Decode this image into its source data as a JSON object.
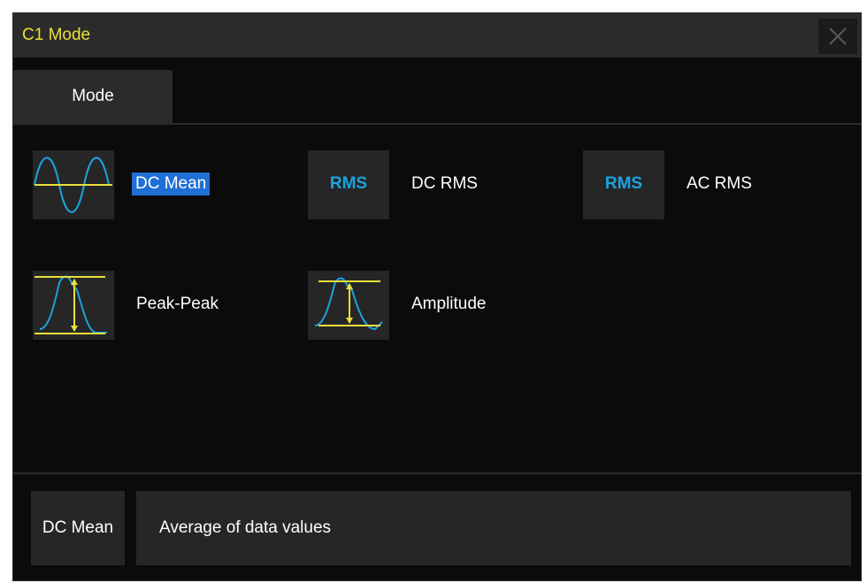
{
  "dialog": {
    "title": "C1 Mode",
    "close_icon": "close-icon"
  },
  "tabs": [
    {
      "label": "Mode",
      "active": true
    }
  ],
  "options": [
    {
      "label": "DC Mean",
      "icon": "sine-wave-icon",
      "selected": true
    },
    {
      "label": "DC RMS",
      "icon_text": "RMS",
      "selected": false
    },
    {
      "label": "AC RMS",
      "icon_text": "RMS",
      "selected": false
    },
    {
      "label": "Peak-Peak",
      "icon": "peak-peak-icon",
      "selected": false
    },
    {
      "label": "Amplitude",
      "icon": "amplitude-icon",
      "selected": false
    }
  ],
  "description": {
    "name": "DC Mean",
    "text": "Average of data values"
  },
  "colors": {
    "title_text": "#e8e03a",
    "wave": "#1aa3e0",
    "marker": "#e8e03a",
    "selection": "#1f6fd6"
  }
}
